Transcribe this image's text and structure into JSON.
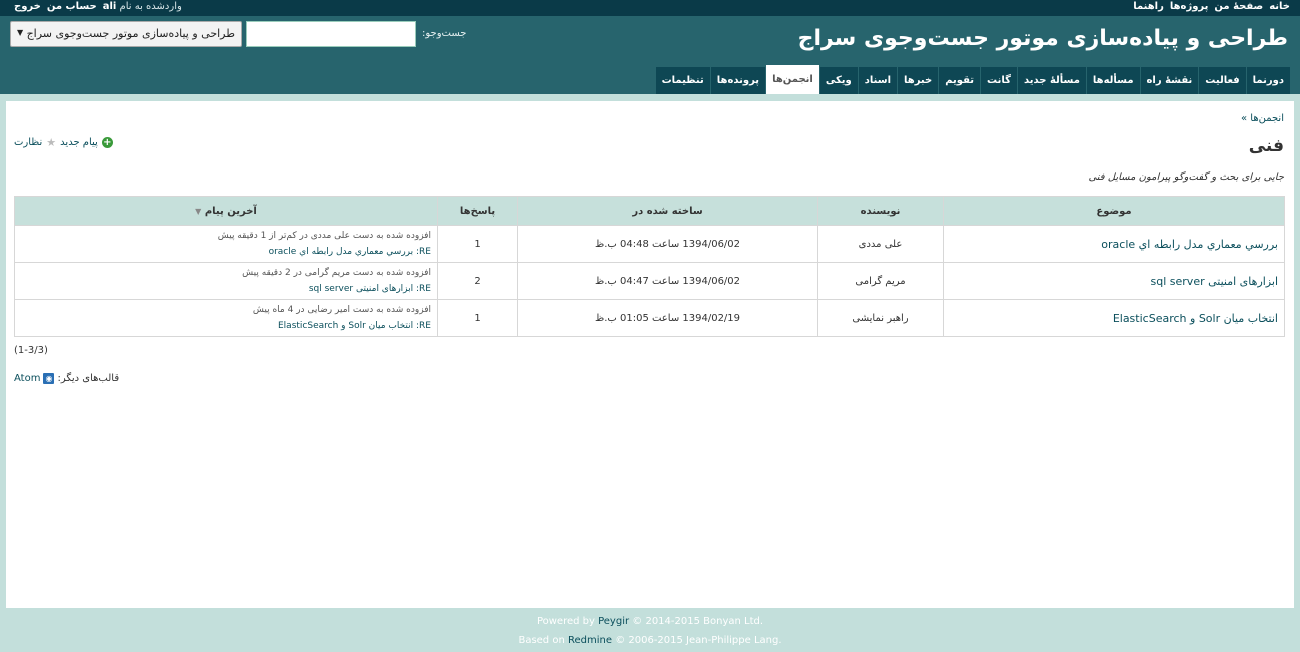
{
  "top_menu": {
    "right_items": [
      "خانه",
      "صفحهٔ من",
      "پروژه‌ها",
      "راهنما"
    ],
    "logged_as_prefix": "وارد‌شده به نام",
    "username": "ali",
    "my_account": "حساب من",
    "logout": "خروج"
  },
  "header": {
    "project_title": "طراحی و پیاده‌سازی موتور جست‌وجوی سراج",
    "search_label": "جست‌وجو:",
    "search_value": "",
    "jump_selected": "طراحی و پیاده‌سازی موتور جست‌وجوی سراج"
  },
  "main_menu": [
    {
      "label": "دورنما",
      "selected": false
    },
    {
      "label": "فعالیت",
      "selected": false
    },
    {
      "label": "نقشهٔ راه",
      "selected": false
    },
    {
      "label": "مسأله‌ها",
      "selected": false
    },
    {
      "label": "مسألهٔ جدید",
      "selected": false
    },
    {
      "label": "گانت",
      "selected": false
    },
    {
      "label": "تقویم",
      "selected": false
    },
    {
      "label": "خبرها",
      "selected": false
    },
    {
      "label": "اسناد",
      "selected": false
    },
    {
      "label": "ویکی",
      "selected": false
    },
    {
      "label": "انجمن‌ها",
      "selected": true
    },
    {
      "label": "پرونده‌ها",
      "selected": false
    },
    {
      "label": "تنظیمات",
      "selected": false
    }
  ],
  "content": {
    "breadcrumb": "انجمن‌ها »",
    "new_message": "پیام جدید",
    "watch": "نظارت",
    "board_title": "فنی",
    "board_description": "جایی برای بحث و گفت‌وگو پیرامون مسایل فنی",
    "table_headers": {
      "subject": "موضوع",
      "author": "نویسنده",
      "created": "ساخته شده در",
      "replies": "پاسخ‌ها",
      "last_message": "آخرین پیام"
    },
    "rows": [
      {
        "subject": "بررسي معماري مدل رابطه اي oracle",
        "author": "علی مددی",
        "created": "1394/06/02 ساعت 04:48 ب.ظ",
        "replies": "1",
        "last_line1": "افزوده شده به دست علی مددی در کم‌تر از 1 دقیقه پیش",
        "last_line2": "RE: بررسي معماري مدل رابطه اي oracle"
      },
      {
        "subject": "ابزارهای امنیتی sql server",
        "author": "مریم گرامی",
        "created": "1394/06/02 ساعت 04:47 ب.ظ",
        "replies": "2",
        "last_line1": "افزوده شده به دست مریم گرامی در 2 دقیقه پیش",
        "last_line2": "RE: ابزارهای امنیتی sql server"
      },
      {
        "subject": "انتخاب میان Solr و ElasticSearch",
        "author": "راهبر نمایشی",
        "created": "1394/02/19 ساعت 01:05 ب.ظ",
        "replies": "1",
        "last_line1": "افزوده شده به دست امیر رضایی در 4 ماه پیش",
        "last_line2": "RE: انتخاب میان Solr و ElasticSearch"
      }
    ],
    "pagination": "(1-3/3)",
    "other_formats_label": "قالب‌های دیگر:",
    "atom": "Atom"
  },
  "footer": {
    "powered_by": "Powered by",
    "peygir": "Peygir",
    "copyright1": "© 2014-2015 Bonyan Ltd.",
    "based_on": "Based on",
    "redmine": "Redmine",
    "copyright2": "© 2006-2015 Jean-Philippe Lang."
  }
}
